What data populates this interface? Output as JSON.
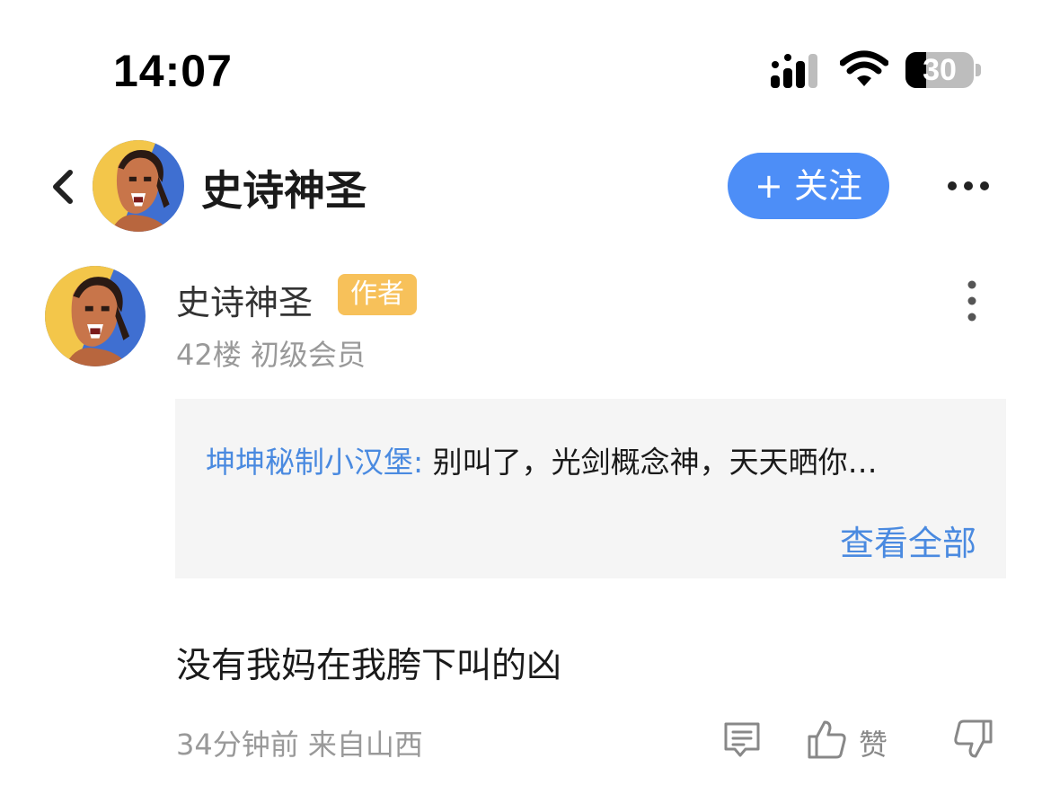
{
  "status_bar": {
    "time": "14:07",
    "battery_level": "30",
    "icons": [
      "signal-icon",
      "wifi-icon",
      "battery-icon"
    ]
  },
  "header": {
    "back_icon": "chevron-left-icon",
    "username": "史诗神圣",
    "follow_label": "+ 关注",
    "more_icon": "more-horizontal-icon"
  },
  "post": {
    "author": "史诗神圣",
    "badge": "作者",
    "meta": "42楼 初级会员",
    "more_icon": "more-vertical-icon",
    "quote": {
      "name": "坤坤秘制小汉堡:",
      "text": "别叫了，光剑概念神，天天晒你…",
      "view_all": "查看全部"
    },
    "body": "没有我妈在我胯下叫的凶",
    "footer_meta": "34分钟前 来自山西",
    "actions": {
      "reply_icon": "comment-icon",
      "like_icon": "thumbs-up-icon",
      "like_label": "赞",
      "dislike_icon": "thumbs-down-icon"
    }
  },
  "colors": {
    "accent_blue": "#4d8ef7",
    "link_blue": "#4a8ae0",
    "badge_yellow": "#f7c15a",
    "quote_bg": "#f5f5f5",
    "meta_gray": "#999999"
  }
}
